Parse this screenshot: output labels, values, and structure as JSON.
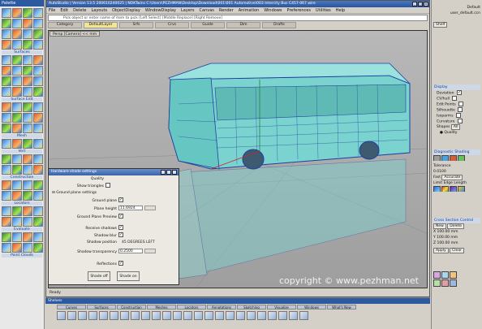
{
  "app": {
    "title": "AutoStudio | Version 13.5  200610240025 | NOKTwins C:\\Users\\PEZHMAN\\Desktop\\Download\\001\\001 Automotive\\003 Intercity Bus C457-067.wire",
    "window_buttons": [
      "_",
      "□",
      "x"
    ]
  },
  "menus": [
    "File",
    "Edit",
    "Delete",
    "Layouts",
    "ObjectDisplay",
    "WindowDisplay",
    "Layers",
    "Canvas",
    "Render",
    "Animation",
    "Windows",
    "Preferences",
    "Utilities",
    "Help"
  ],
  "prompt_text": "Pick object or enter name of item to pick [Left Select] [Middle Replace] [Right Remove]",
  "shelf_tabs": [
    "Category",
    "DefaultLayer",
    "Srfs",
    "Crvs",
    "Guide",
    "Dim",
    "Drafts"
  ],
  "viewport": {
    "label": "Persp [Camera]  <<   mm",
    "watermark": "copyright © www.pezhman.net"
  },
  "status": "Ready",
  "left_palette": {
    "title": "Palette",
    "sections": [
      "Surfaces",
      "Surface Edit",
      "Mesh",
      "Vert",
      "Construction",
      "Locators",
      "Evaluate",
      "Point Clouds"
    ]
  },
  "dialog": {
    "title": "Hardware shade settings",
    "quality_label": "Quality",
    "show_triangles_label": "Show triangles",
    "group_label": "Ground plane settings",
    "ground_plane_label": "Ground plane",
    "plane_height_label": "Plane height",
    "plane_height_value": "11.6924",
    "ground_plane_preview_label": "Ground Plane Preview",
    "receive_shadows_label": "Receive shadows",
    "shadow_blur_label": "Shadow blur",
    "shadow_blur_value": "0.0000",
    "shadow_position_label": "Shadow position",
    "shadow_position_value": "45 DEGREES LEFT",
    "shadow_transparency_label": "Shadow transparency",
    "shadow_transparency_value": "0.2500",
    "reflections_label": "Reflections",
    "shade_off_label": "Shade off",
    "shade_on_label": "Shade on"
  },
  "right_panel": {
    "layer_name": "Default",
    "layer_file": "user_default.ccn",
    "shelf_tab": "Shelf",
    "section_display": "Display",
    "display_items": [
      "Deviation",
      "CV/hull",
      "Edit Points",
      "Silhouette",
      "Isoparms",
      "Curvature"
    ],
    "shapes_label": "Shapes",
    "shapes_value": "All",
    "quality_label": "Quality",
    "diagnostic_label": "Diagnostic Shading",
    "tolerance_label": "Tolerance",
    "tolerance_value": "0.0100",
    "fast_label": "Fast",
    "accurate_label": "Accurate",
    "limit_edge_label": "Limit Edge Length",
    "cross_section_label": "Cross Section Control",
    "new_label": "New",
    "delete_label": "Delete",
    "cross_rows": [
      "X 100.00 mm",
      "Y 100.00 mm",
      "Z 100.00 mm"
    ],
    "apply_label": "Apply",
    "clear_label": "Clear"
  },
  "bottom_shelf": {
    "title": "Shelves",
    "tabs": [
      "Curves",
      "Surfaces",
      "Construction",
      "Meshes",
      "Locators",
      "Annotations",
      "Sketching",
      "Visualize",
      "Windows",
      "What's New"
    ]
  },
  "colors": {
    "bus_body": "#7ad3cf",
    "bus_wire": "#1f3fa0",
    "viewport_bg": "#a8a8a8",
    "title_blue": "#2c5aa0"
  }
}
